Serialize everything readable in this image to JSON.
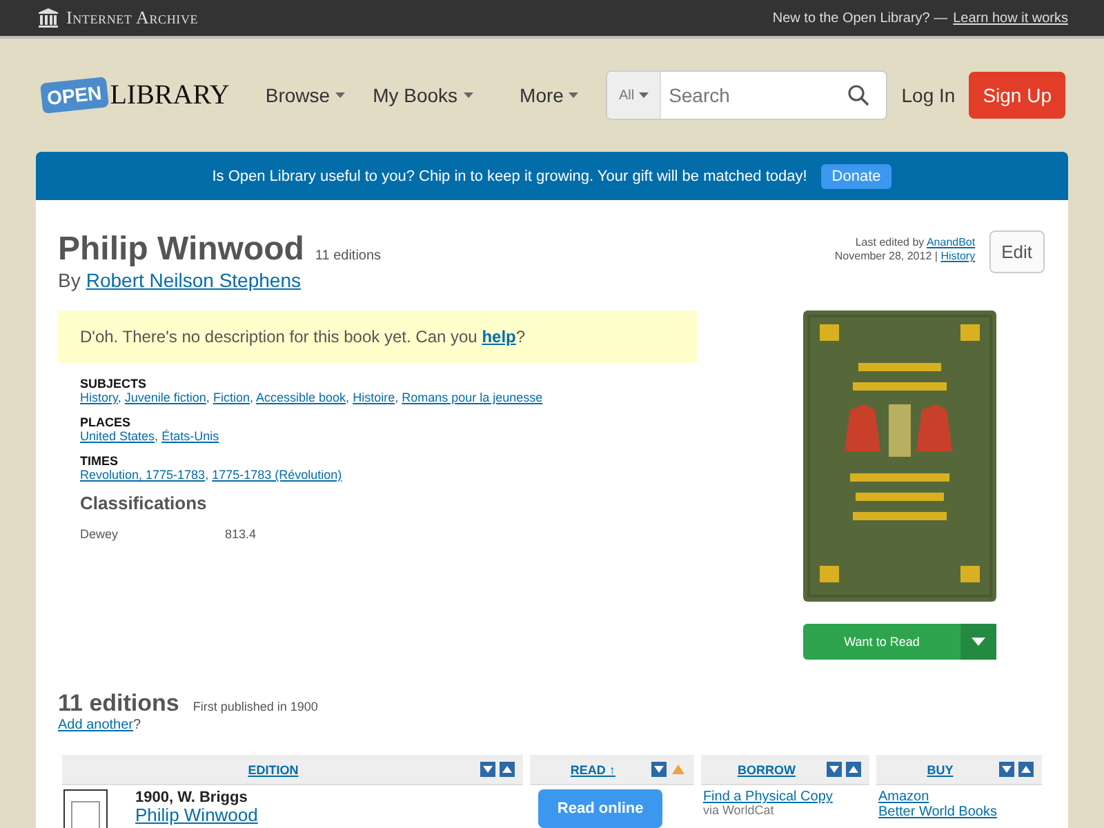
{
  "top_bar": {
    "brand": "Internet Archive",
    "prompt": "New to the Open Library? —",
    "prompt_link": "Learn how it works"
  },
  "header": {
    "logo_badge": "OPEN",
    "logo_word": "LIBRARY",
    "nav": [
      {
        "label": "Browse"
      },
      {
        "label": "My Books"
      },
      {
        "label": "More"
      }
    ],
    "search": {
      "scope": "All",
      "placeholder": "Search"
    },
    "login": "Log In",
    "signup": "Sign Up"
  },
  "banner": {
    "text": "Is Open Library useful to you? Chip in to keep it growing. Your gift will be matched today!",
    "button": "Donate"
  },
  "work": {
    "title": "Philip Winwood",
    "editions_count": "11 editions",
    "by": "By",
    "author": "Robert Neilson Stephens",
    "last_edited_prefix": "Last edited by",
    "last_edited_by": "AnandBot",
    "last_edited_date": "November 28, 2012 |",
    "history": "History",
    "edit": "Edit",
    "description": "D'oh. There's no description for this book yet. Can you **help**?",
    "facets": [
      {
        "heading": "SUBJECTS",
        "separator": ",",
        "links": [
          "History",
          "Juvenile fiction",
          "Fiction",
          "Accessible book",
          "Histoire",
          "Romans pour la jeunesse"
        ]
      },
      {
        "heading": "PLACES",
        "separator": ",",
        "links": [
          "United States",
          "États-Unis"
        ]
      },
      {
        "heading": "TIMES",
        "separator": ",",
        "links": [
          "Revolution, 1775-1783",
          "1775-1783 (Révolution)"
        ]
      }
    ],
    "classifications": {
      "heading": "Classifications",
      "rows": [
        {
          "label": "Dewey",
          "value": "813.4"
        }
      ]
    },
    "want_to_read": "Want to Read"
  },
  "editions": {
    "heading": "11 editions",
    "first_published": "First published in 1900",
    "add_another": "Add another",
    "add_suffix": "?",
    "columns": [
      {
        "label": "EDITION",
        "sort_active": false
      },
      {
        "label": "READ ↑",
        "sort_active": true
      },
      {
        "label": "BORROW",
        "sort_active": false
      },
      {
        "label": "BUY",
        "sort_active": false
      }
    ],
    "rows": [
      {
        "year_publisher": "1900, W. Briggs",
        "title": "Philip Winwood",
        "read": "Read online",
        "borrow": "Find a Physical Copy",
        "borrow_note": "via WorldCat",
        "buy": [
          "Amazon",
          "Better World Books"
        ]
      }
    ]
  }
}
